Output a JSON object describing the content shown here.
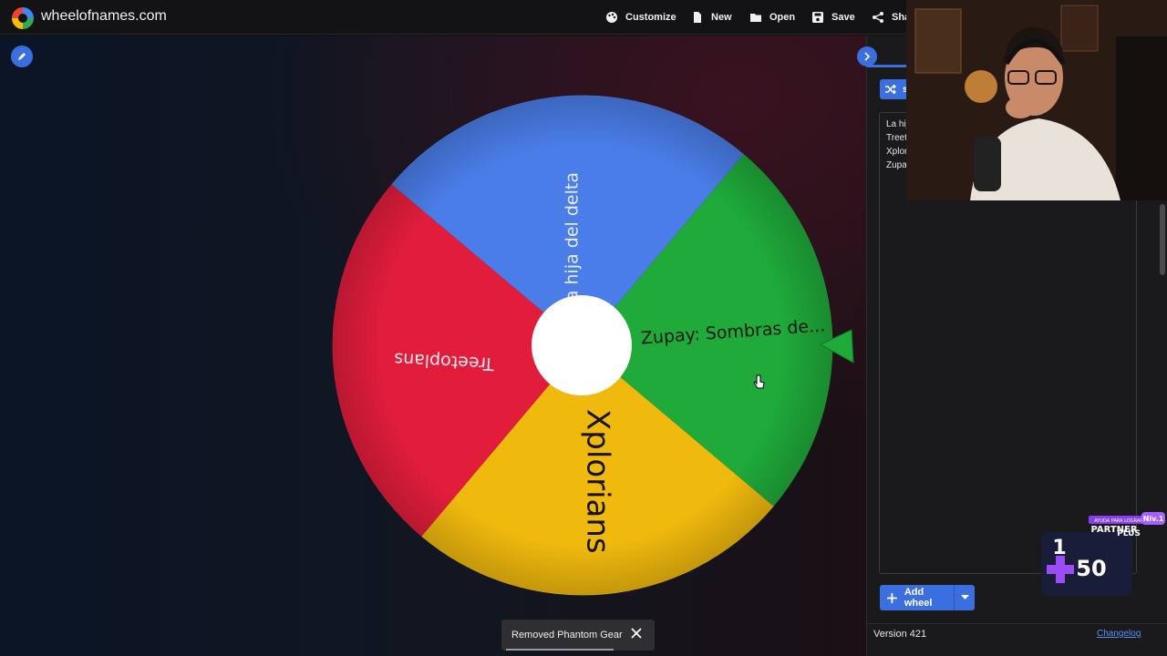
{
  "header": {
    "site_title": "wheelofnames.com",
    "customize_label": "Customize",
    "new_label": "New",
    "open_label": "Open",
    "save_label": "Save",
    "share_label": "Sha"
  },
  "wheel": {
    "slices": [
      {
        "label": "La hija del delta",
        "color": "#4a7de8"
      },
      {
        "label": "Zupay: Sombras de...",
        "color": "#1faa3a"
      },
      {
        "label": "Xplorians",
        "color": "#f0b90e"
      },
      {
        "label": "Treetoplans",
        "color": "#e21d3c"
      }
    ],
    "hub_color": "#ffffff",
    "pointer_color": "#1faa3a"
  },
  "sidebar": {
    "shuffle_label": "s",
    "entries": [
      "La hij",
      "Treet",
      "Xplor",
      "Zupa"
    ],
    "add_wheel_label": "Add wheel",
    "version": "Version 421",
    "changelog": "Changelog"
  },
  "toast": {
    "message": "Removed Phantom Gear"
  },
  "overlay": {
    "badge_top": "AYUDA PARA LOGRAR",
    "partner": "PARTNER",
    "plus": "PLUS",
    "level": "Niv.1",
    "count_a": "1",
    "count_b": "50"
  },
  "colors": {
    "accent": "#3b6fe0",
    "purple": "#8a3df0"
  }
}
